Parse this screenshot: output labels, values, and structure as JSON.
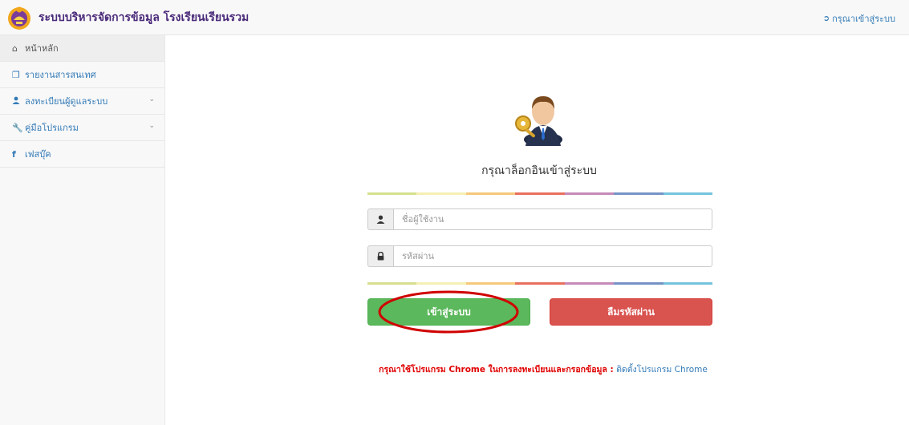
{
  "header": {
    "title": "ระบบบริหารจัดการข้อมูล โรงเรียนเรียนรวม",
    "logo": "school-emblem-logo",
    "login_link": "กรุณาเข้าสู่ระบบ",
    "login_icon": "sign-in-icon"
  },
  "sidebar": {
    "items": [
      {
        "label": "หน้าหลัก",
        "icon": "home-icon"
      },
      {
        "label": "รายงานสารสนเทศ",
        "icon": "copy-icon"
      },
      {
        "label": "ลงทะเบียนผู้ดูแลระบบ",
        "icon": "user-icon"
      },
      {
        "label": "คู่มือโปรแกรม",
        "icon": "wrench-icon"
      },
      {
        "label": "เฟสบุ๊ค",
        "icon": "facebook-icon"
      }
    ]
  },
  "login": {
    "avatar": "businessman-key-icon",
    "title": "กรุณาล็อกอินเข้าสู่ระบบ",
    "username_placeholder": "ชื่อผู้ใช้งาน",
    "password_placeholder": "รหัสผ่าน",
    "login_button": "เข้าสู่ระบบ",
    "forgot_button": "ลืมรหัสผ่าน"
  },
  "notice": {
    "warning": "กรุณาใช้โปรแกรม Chrome ในการลงทะเบียนและกรอกข้อมูล :",
    "link": "ติดตั้งโปรแกรม Chrome"
  },
  "colors": {
    "brand_title": "#4a2a7a",
    "link": "#337ab7",
    "login_button": "#5cb85c",
    "forgot_button": "#d9534f",
    "warning_text": "#e00000",
    "annotation_ellipse": "#d00000",
    "rainbow": [
      "#d7df8e",
      "#f6efb4",
      "#f6c87a",
      "#e96f5d",
      "#c58ab7",
      "#7692c5",
      "#74c4dc"
    ]
  }
}
